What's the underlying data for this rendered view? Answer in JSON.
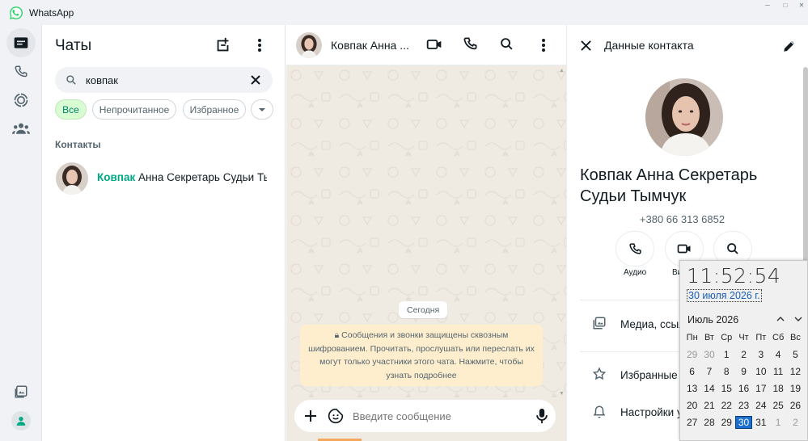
{
  "window": {
    "title": "WhatsApp",
    "brand_color": "#25d366",
    "accent": "#00a884"
  },
  "sidebar": {
    "chats_title": "Чаты",
    "search": {
      "value": "ковпак"
    },
    "filters": [
      {
        "label": "Все",
        "active": true
      },
      {
        "label": "Непрочитанное",
        "active": false
      },
      {
        "label": "Избранное",
        "active": false
      }
    ],
    "section_label": "Контакты",
    "contact": {
      "name_highlight": "Ковпак",
      "name_rest": " Анна Секретарь Судьи Тым"
    }
  },
  "chat": {
    "header_name": "Ковпак Анна ...",
    "date_chip": "Сегодня",
    "encryption_notice": "Сообщения и звонки защищены сквозным шифрованием. Прочитать, прослушать или переслать их могут только участники этого чата. Нажмите, чтобы узнать подробнее",
    "composer_placeholder": "Введите сообщение"
  },
  "contact_info": {
    "title": "Данные контакта",
    "name": "Ковпак Анна Секретарь Судьи Тымчук",
    "phone": "+380 66 313 6852",
    "actions": [
      {
        "label": "Аудио",
        "icon": "phone-icon"
      },
      {
        "label": "Ви",
        "icon": "video-icon"
      },
      {
        "label": "",
        "icon": "search-icon"
      }
    ],
    "rows": [
      {
        "label": "Медиа, ссыл",
        "icon": "media-icon"
      },
      {
        "label": "Избранные",
        "icon": "star-icon"
      },
      {
        "label": "Настройки у",
        "icon": "bell-icon"
      }
    ]
  },
  "clock_popup": {
    "time": "11:52:54",
    "date": "30 июля 2026 г.",
    "month": "Июль 2026",
    "weekdays": [
      "Пн",
      "Вт",
      "Ср",
      "Чт",
      "Пт",
      "Сб",
      "Вс"
    ],
    "weeks": [
      [
        "29",
        "30",
        "1",
        "2",
        "3",
        "4",
        "5"
      ],
      [
        "6",
        "7",
        "8",
        "9",
        "10",
        "11",
        "12"
      ],
      [
        "13",
        "14",
        "15",
        "16",
        "17",
        "18",
        "19"
      ],
      [
        "20",
        "21",
        "22",
        "23",
        "24",
        "25",
        "26"
      ],
      [
        "27",
        "28",
        "29",
        "30",
        "31",
        "1",
        "2"
      ]
    ],
    "selected_day": "30"
  }
}
